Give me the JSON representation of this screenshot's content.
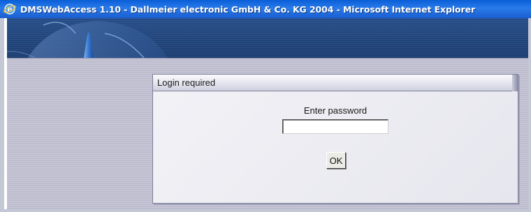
{
  "window": {
    "title": "DMSWebAccess 1.10 - Dallmeier electronic GmbH & Co. KG 2004 - Microsoft Internet Explorer",
    "icon": "internet-explorer-icon"
  },
  "banner": {
    "logo": "dallmeier-arc-logo"
  },
  "login_dialog": {
    "header": "Login required",
    "password_label": "Enter password",
    "password_value": "",
    "ok_label": "OK"
  },
  "colors": {
    "titlebar": "#0a5fd8",
    "banner": "#20447a",
    "background": "#bdbdcf",
    "dialog": "#ececf2"
  }
}
